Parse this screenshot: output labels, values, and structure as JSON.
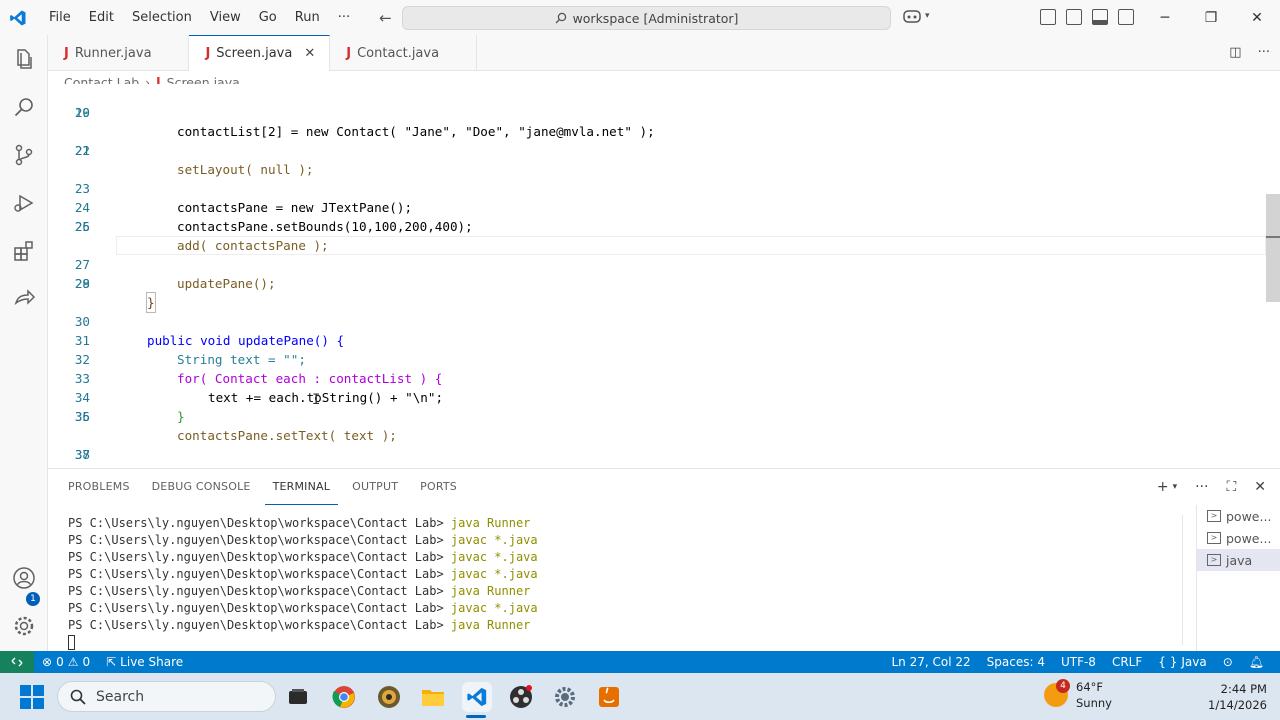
{
  "titlebar": {
    "menu": [
      "File",
      "Edit",
      "Selection",
      "View",
      "Go",
      "Run",
      "···"
    ],
    "command_center": "workspace [Administrator]"
  },
  "tabs": [
    {
      "label": "Runner.java",
      "active": false
    },
    {
      "label": "Screen.java",
      "active": true
    },
    {
      "label": "Contact.java",
      "active": false
    }
  ],
  "breadcrumb": {
    "folder": "Contact Lab",
    "file": "Screen.java"
  },
  "editor": {
    "lines": [
      {
        "n": "19",
        "top": 0
      },
      {
        "n": "20"
      },
      {
        "n": "21"
      },
      {
        "n": "22"
      },
      {
        "n": "23"
      },
      {
        "n": "24"
      },
      {
        "n": "25"
      },
      {
        "n": "26"
      },
      {
        "n": "27"
      },
      {
        "n": "28"
      },
      {
        "n": "29"
      },
      {
        "n": "30"
      },
      {
        "n": "31"
      },
      {
        "n": "32"
      },
      {
        "n": "33"
      },
      {
        "n": "34"
      },
      {
        "n": "35"
      },
      {
        "n": "36"
      },
      {
        "n": "37"
      },
      {
        "n": "38"
      }
    ],
    "code": {
      "l19": "contactList[2] = new Contact( \"Jane\", \"Doe\", \"jane@mvla.net\" );",
      "l21": "setLayout( null );",
      "l23": "contactsPane = new JTextPane();",
      "l24": "contactsPane.setBounds(10,100,200,400);",
      "l25": "add( contactsPane );",
      "l27": "updatePane();",
      "l28": "}",
      "l30": "public void updatePane() {",
      "l31": "String text = \"\";",
      "l32": "for( Contact each : contactList ) {",
      "l33": "text += each.toString() + \"\\n\";",
      "l34": "}",
      "l35": "contactsPane.setText( text );",
      "l37": "}"
    }
  },
  "panel": {
    "tabs": [
      "PROBLEMS",
      "DEBUG CONSOLE",
      "TERMINAL",
      "OUTPUT",
      "PORTS"
    ],
    "active_tab": "TERMINAL",
    "prompt": "PS C:\\Users\\ly.nguyen\\Desktop\\workspace\\Contact Lab>",
    "history": [
      "java Runner",
      "javac *.java",
      "javac *.java",
      "javac *.java",
      "java Runner",
      "javac *.java",
      "java Runner"
    ],
    "terminals": [
      "powe...",
      "powe...",
      "java"
    ]
  },
  "statusbar": {
    "errors": "0",
    "warnings": "0",
    "live_share": "Live Share",
    "position": "Ln 27, Col 22",
    "spaces": "Spaces: 4",
    "encoding": "UTF-8",
    "eol": "CRLF",
    "language": "Java",
    "language_icon": "{ }"
  },
  "taskbar": {
    "search_placeholder": "Search",
    "weather_temp": "64°F",
    "weather_desc": "Sunny",
    "weather_badge": "4",
    "time": "2:44 PM",
    "date": "1/14/2026"
  },
  "activity_badge": "1",
  "colors": {
    "accent": "#005fb8",
    "statusbar": "#007acc",
    "remote": "#16825d"
  }
}
